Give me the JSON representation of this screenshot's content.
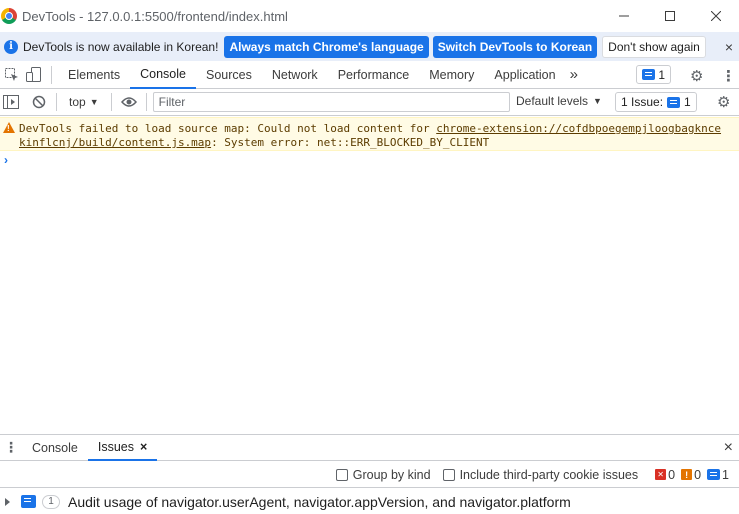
{
  "window": {
    "title": "DevTools - 127.0.0.1:5500/frontend/index.html",
    "controls": [
      "minimize-icon",
      "maximize-icon",
      "close-icon"
    ]
  },
  "infobar": {
    "message": "DevTools is now available in Korean!",
    "match_language_label": "Always match Chrome's language",
    "switch_label": "Switch DevTools to Korean",
    "dismiss_label": "Don't show again",
    "close": "×"
  },
  "tabs": {
    "items": [
      "Elements",
      "Console",
      "Sources",
      "Network",
      "Performance",
      "Memory",
      "Application"
    ],
    "active": "Console",
    "more": "»",
    "issues_count": "1"
  },
  "console_toolbar": {
    "context": "top",
    "filter_placeholder": "Filter",
    "levels_label": "Default levels",
    "issues_label": "1 Issue:",
    "issues_count": "1"
  },
  "messages": [
    {
      "level": "warning",
      "line1_prefix": "DevTools failed to load source map: Could not load content for ",
      "link_part1": "chrome-extension://cofdbpoegempjloogbagknce",
      "link_part2": "kinflcnj/build/content.js.map",
      "line2_suffix": ": System error: net::ERR_BLOCKED_BY_CLIENT"
    }
  ],
  "prompt_symbol": "›",
  "drawer": {
    "tabs": [
      "Console",
      "Issues"
    ],
    "active": "Issues",
    "tab_close": "×",
    "close": "×"
  },
  "issues_toolbar": {
    "group_by_kind": "Group by kind",
    "include_third_party": "Include third-party cookie issues",
    "errors": "0",
    "warnings": "0",
    "info": "1"
  },
  "issue_rows": [
    {
      "count": "1",
      "text": "Audit usage of navigator.userAgent, navigator.appVersion, and navigator.platform"
    }
  ],
  "colors": {
    "accent": "#1a73e8",
    "infobar_bg": "#e8eef9",
    "warning_bg": "#fffbe5",
    "warning_text": "#5c3c00",
    "error": "#d93025",
    "warning": "#e37400"
  }
}
